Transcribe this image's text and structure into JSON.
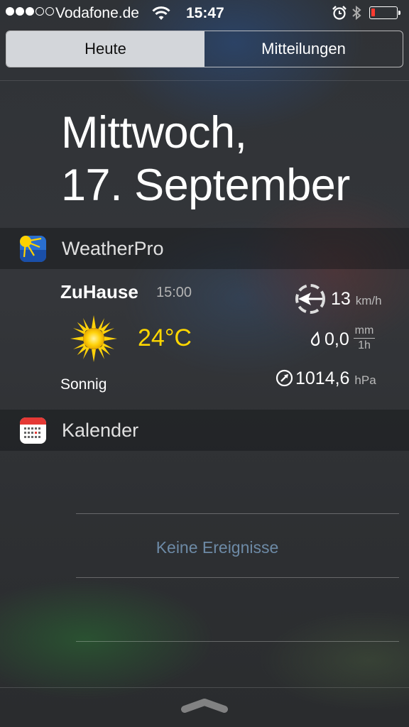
{
  "status_bar": {
    "carrier": "Vodafone.de",
    "time": "15:47",
    "signal_bars_filled": 3,
    "signal_bars_total": 5,
    "battery_level": 0.15,
    "battery_color": "#ff3b30"
  },
  "tabs": [
    {
      "label": "Heute",
      "active": true
    },
    {
      "label": "Mitteilungen",
      "active": false
    }
  ],
  "date": {
    "line1": "Mittwoch,",
    "line2": "17. September"
  },
  "weather_widget": {
    "title": "WeatherPro",
    "icon": "weatherpro-app-icon",
    "location": "ZuHause",
    "time": "15:00",
    "condition_icon": "sun-icon",
    "temperature": "24°C",
    "temperature_color": "#ffd700",
    "condition": "Sonnig",
    "wind_value": "13",
    "wind_unit": "km/h",
    "precip_value": "0,0",
    "precip_unit_top": "mm",
    "precip_unit_bottom": "1h",
    "pressure_value": "1014,6",
    "pressure_unit": "hPa"
  },
  "calendar_widget": {
    "title": "Kalender",
    "icon": "calendar-app-icon",
    "empty_text": "Keine Ereignisse",
    "empty_text_color": "#6d8aa6"
  },
  "bottom_handle": {
    "icon": "chevron-up-handle-icon"
  }
}
